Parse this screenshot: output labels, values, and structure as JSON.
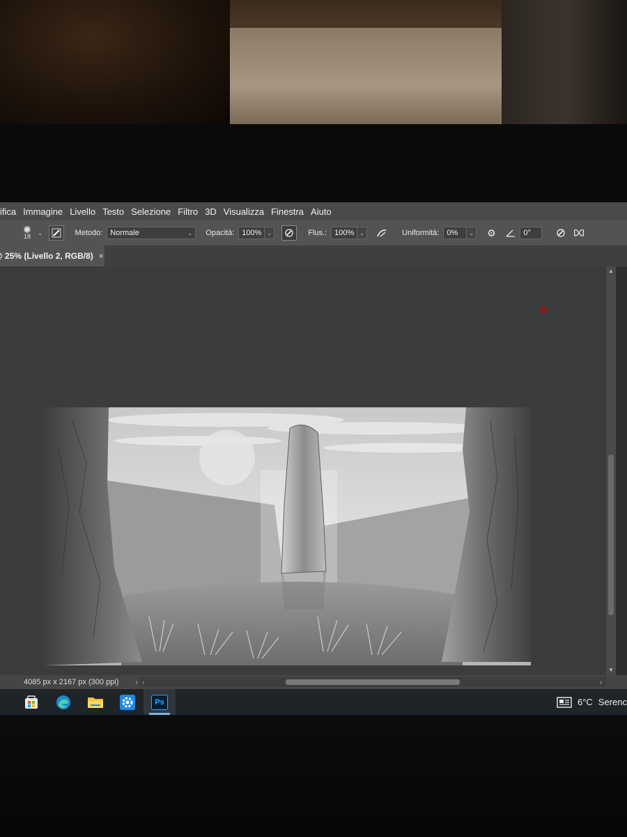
{
  "menu": {
    "items": [
      "ifica",
      "Immagine",
      "Livello",
      "Testo",
      "Selezione",
      "Filtro",
      "3D",
      "Visualizza",
      "Finestra",
      "Aiuto"
    ]
  },
  "options": {
    "brush_size": "18",
    "mode_label": "Metodo:",
    "mode_value": "Normale",
    "opacity_label": "Opacità:",
    "opacity_value": "100%",
    "flow_label": "Flus.:",
    "flow_value": "100%",
    "smoothing_label": "Uniformità:",
    "smoothing_value": "0%",
    "angle_value": "0°"
  },
  "document": {
    "tab_title": "@ 25% (Livello 2, RGB/8)",
    "tab_close": "×",
    "size_info": "4085 px x 2167 px (300 ppi)"
  },
  "taskbar": {
    "apps": [
      "start-icon",
      "edge-icon",
      "file-explorer-icon",
      "settings-icon",
      "photoshop-icon"
    ],
    "photoshop_label": "Ps",
    "weather_temp": "6°C",
    "weather_desc": "Serenc"
  },
  "colors": {
    "menubar_bg": "#4a4a4a",
    "optionsbar_bg": "#535353",
    "canvas_bg": "#3b3c3d",
    "taskbar_bg": "#1f2428",
    "ps_blue": "#31a8ff"
  }
}
